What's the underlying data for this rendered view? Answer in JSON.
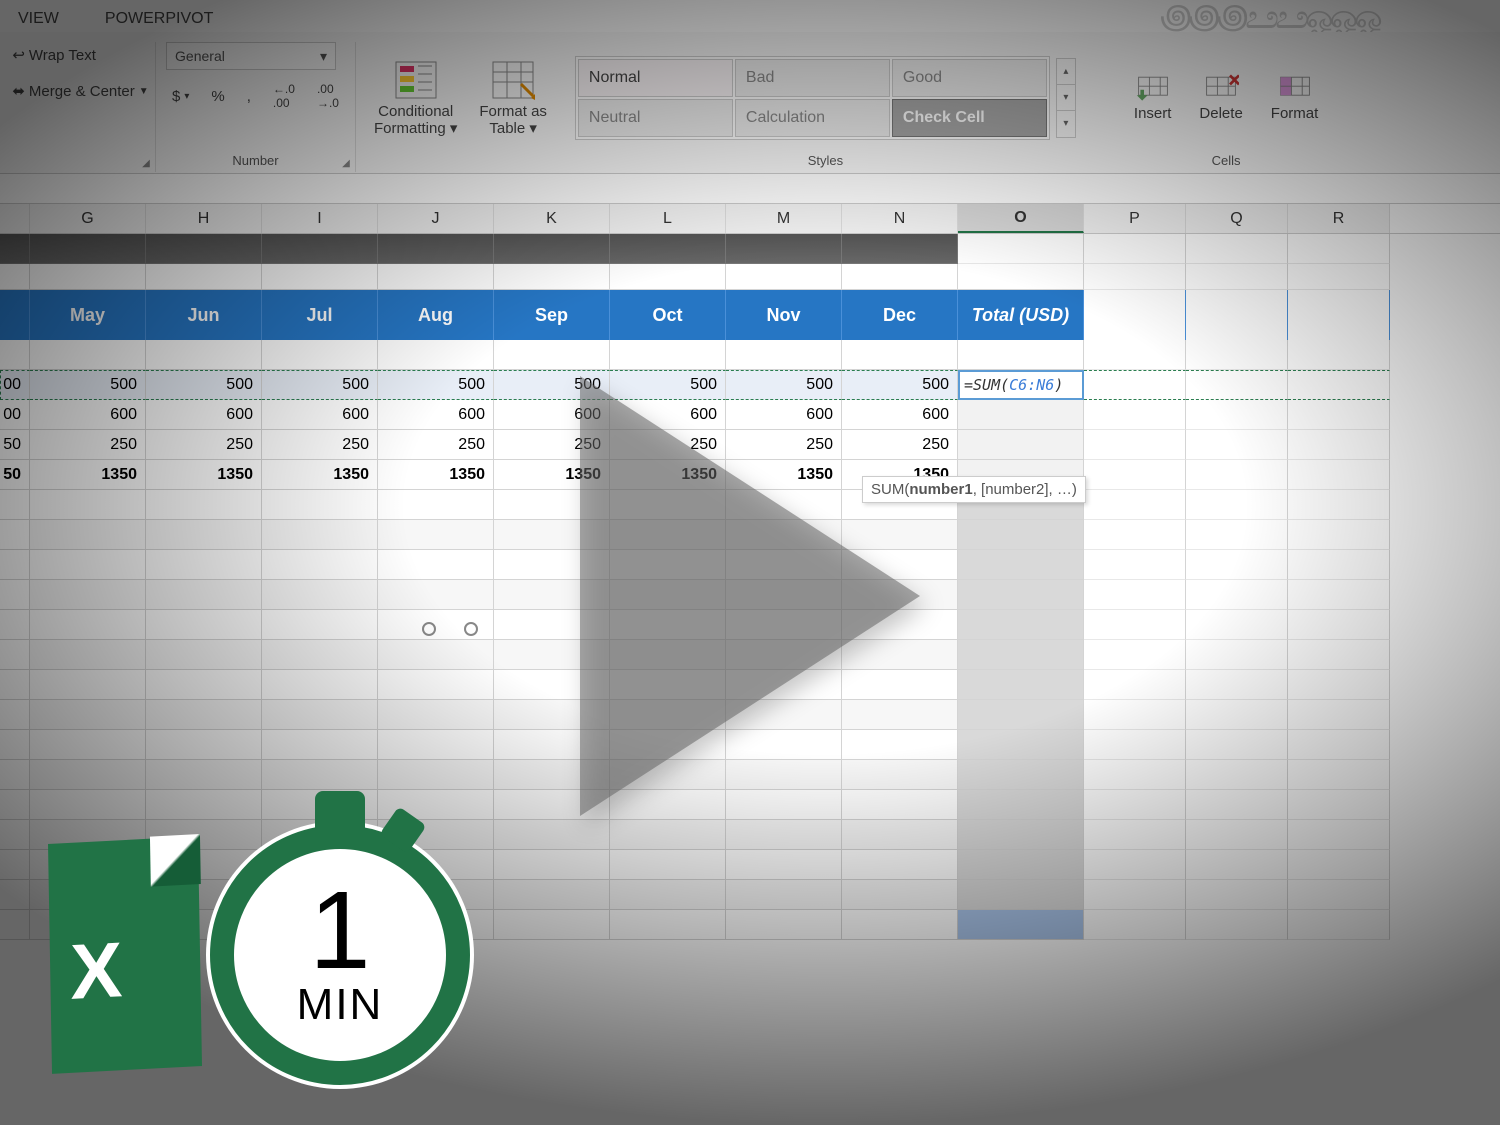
{
  "tabs": {
    "view": "VIEW",
    "powerpivot": "POWERPIVOT"
  },
  "ribbon": {
    "alignment": {
      "wrap": "Wrap Text",
      "merge": "Merge & Center"
    },
    "number": {
      "label": "Number",
      "format": "General",
      "currency": "$",
      "percent": "%",
      "comma": ",",
      "inc": ".0",
      "dec": ".00"
    },
    "conditional": "Conditional\nFormatting",
    "format_table": "Format as\nTable",
    "styles": {
      "label": "Styles",
      "items": {
        "normal": "Normal",
        "bad": "Bad",
        "good": "Good",
        "neutral": "Neutral",
        "calculation": "Calculation",
        "check": "Check Cell"
      }
    },
    "cells": {
      "label": "Cells",
      "insert": "Insert",
      "delete": "Delete",
      "format": "Format"
    }
  },
  "columns": [
    "G",
    "H",
    "I",
    "J",
    "K",
    "L",
    "M",
    "N",
    "O",
    "P",
    "Q",
    "R"
  ],
  "active_column": "O",
  "col_widths": {
    "stub": 30,
    "std": 116,
    "O": 126,
    "tail": 102
  },
  "table": {
    "headers": [
      "May",
      "Jun",
      "Jul",
      "Aug",
      "Sep",
      "Oct",
      "Nov",
      "Dec",
      "Total (USD)"
    ],
    "rows": [
      {
        "stub": "00",
        "vals": [
          500,
          500,
          500,
          500,
          500,
          500,
          500,
          500
        ],
        "formula": true
      },
      {
        "stub": "00",
        "vals": [
          600,
          600,
          600,
          600,
          600,
          600,
          600,
          600
        ]
      },
      {
        "stub": "50",
        "vals": [
          250,
          250,
          250,
          250,
          250,
          250,
          250,
          250
        ]
      },
      {
        "stub": "50",
        "vals": [
          1350,
          1350,
          1350,
          1350,
          1350,
          1350,
          1350,
          1350
        ],
        "bold": true
      }
    ]
  },
  "formula": {
    "text": "=SUM(",
    "ref": "C6:N6",
    "close": ")"
  },
  "tooltip": {
    "fn": "SUM(",
    "arg1": "number1",
    "rest": ", [number2], …)"
  },
  "watermark": {
    "one": "1",
    "min": "MIN",
    "x": "X"
  }
}
